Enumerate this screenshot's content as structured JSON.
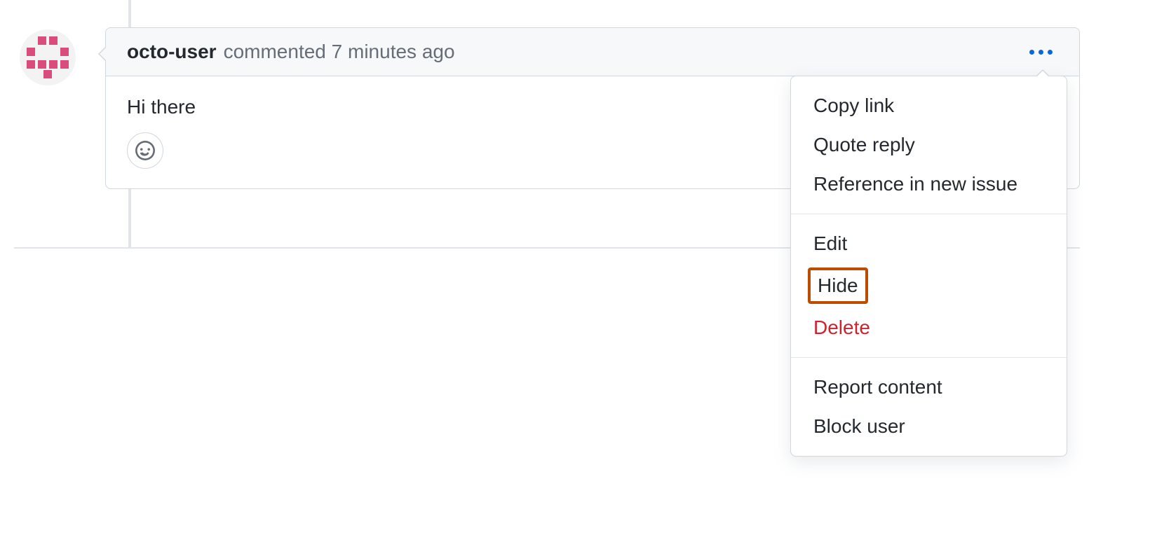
{
  "comment": {
    "username": "octo-user",
    "action_text": "commented 7 minutes ago",
    "body": "Hi there"
  },
  "dropdown": {
    "group1": {
      "copy_link": "Copy link",
      "quote_reply": "Quote reply",
      "reference_issue": "Reference in new issue"
    },
    "group2": {
      "edit": "Edit",
      "hide": "Hide",
      "delete": "Delete"
    },
    "group3": {
      "report": "Report content",
      "block": "Block user"
    }
  }
}
